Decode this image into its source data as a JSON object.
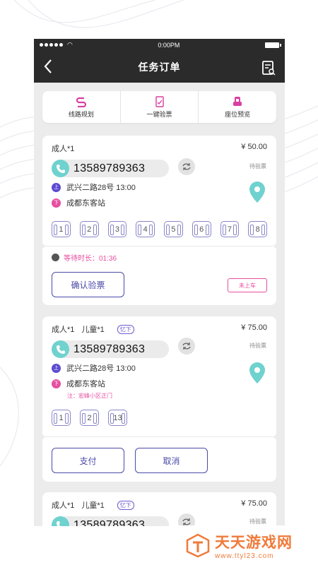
{
  "status_bar": {
    "time": "0:00PM"
  },
  "nav": {
    "title": "任务订单"
  },
  "tabs": [
    {
      "label": "线路规划",
      "icon": "route-icon"
    },
    {
      "label": "一键验票",
      "icon": "ticket-check-icon"
    },
    {
      "label": "座位预览",
      "icon": "seat-preview-icon"
    }
  ],
  "orders": [
    {
      "passengers": "成人*1",
      "child": "",
      "price": "¥ 50.00",
      "phone": "13589789363",
      "status": "待验票",
      "pickup_badge": "上",
      "pickup": "武兴二路28号  13:00",
      "dropoff_badge": "下",
      "dropoff": "成都东客站",
      "note": "",
      "seats": [
        "1",
        "2",
        "3",
        "4",
        "5",
        "6",
        "7",
        "8"
      ],
      "wait_label": "等待时长：01:36",
      "confirm_label": "确认验票",
      "noshow_label": "未上车"
    },
    {
      "passengers": "成人*1",
      "child": "儿童*1",
      "child_tag": "忆下",
      "price": "¥ 75.00",
      "phone": "13589789363",
      "status": "待验票",
      "pickup_badge": "上",
      "pickup": "武兴二路28号  13:00",
      "dropoff_badge": "下",
      "dropoff": "成都东客站",
      "note": "注：宏峰小区正门",
      "seats": [
        "1",
        "2",
        "13"
      ],
      "pay_label": "支付",
      "cancel_label": "取消"
    },
    {
      "passengers": "成人*1",
      "child": "儿童*1",
      "child_tag": "忆下",
      "price": "¥ 75.00",
      "phone": "13589789363",
      "status": "待验票"
    }
  ],
  "watermark": {
    "name": "天天游戏网",
    "url": "www.ttyl23.com"
  },
  "colors": {
    "accent": "#4a4aa8",
    "pink": "#e64fa0",
    "teal": "#6fd2cf",
    "dark_header": "#2b2b2b"
  }
}
